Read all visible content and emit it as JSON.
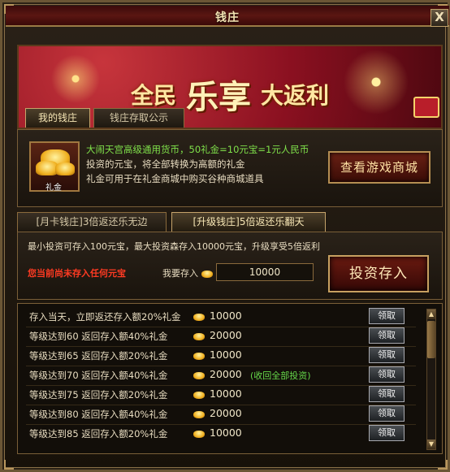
{
  "window": {
    "title": "钱庄",
    "close_label": "X"
  },
  "banner": {
    "slogan_left": "全民",
    "slogan_mid": "乐享",
    "slogan_right": "大返利"
  },
  "top_tabs": [
    {
      "label": "我的钱庄",
      "active": true
    },
    {
      "label": "钱庄存取公示",
      "active": false
    }
  ],
  "info": {
    "icon_label": "礼金",
    "line1": "大闹天宫高级通用货币，50礼金=10元宝=1元人民币",
    "line2": "投资的元宝，将全部转换为高额的礼金",
    "line3": "礼金可用于在礼金商城中购买谷种商城道具",
    "shop_button": "查看游戏商城"
  },
  "mid_tabs": [
    {
      "label": "[月卡钱庄]3倍返还乐无边",
      "active": false
    },
    {
      "label": "[升级钱庄]5倍返还乐翻天",
      "active": true
    }
  ],
  "bank": {
    "rule": "最小投资可存入100元宝，最大投资森存入10000元宝，升级享受5倍返利",
    "notice": "您当前尚未存入任何元宝",
    "deposit_label": "我要存入",
    "deposit_value": "10000",
    "deposit_button": "投资存入"
  },
  "rewards": [
    {
      "label": "存入当天，立即返还存入额20%礼金",
      "amount": "10000",
      "note": "",
      "button": "领取"
    },
    {
      "label": "等级达到60 返回存入额40%礼金",
      "amount": "20000",
      "note": "",
      "button": "领取"
    },
    {
      "label": "等级达到65 返回存入额20%礼金",
      "amount": "10000",
      "note": "",
      "button": "领取"
    },
    {
      "label": "等级达到70 返回存入额40%礼金",
      "amount": "20000",
      "note": "(收回全部投资)",
      "button": "领取"
    },
    {
      "label": "等级达到75 返回存入额20%礼金",
      "amount": "10000",
      "note": "",
      "button": "领取"
    },
    {
      "label": "等级达到80 返回存入额40%礼金",
      "amount": "20000",
      "note": "",
      "button": "领取"
    },
    {
      "label": "等级达到85 返回存入额20%礼金",
      "amount": "10000",
      "note": "",
      "button": "领取"
    }
  ],
  "colors": {
    "accent_gold": "#c5a36a",
    "notice_red": "#ff3a22",
    "info_green": "#7fe04a",
    "title_red": "#5a1612"
  },
  "icons": [
    "close-icon",
    "gold-ingot-icon",
    "coin-icon",
    "scroll-up-icon",
    "scroll-down-icon"
  ]
}
